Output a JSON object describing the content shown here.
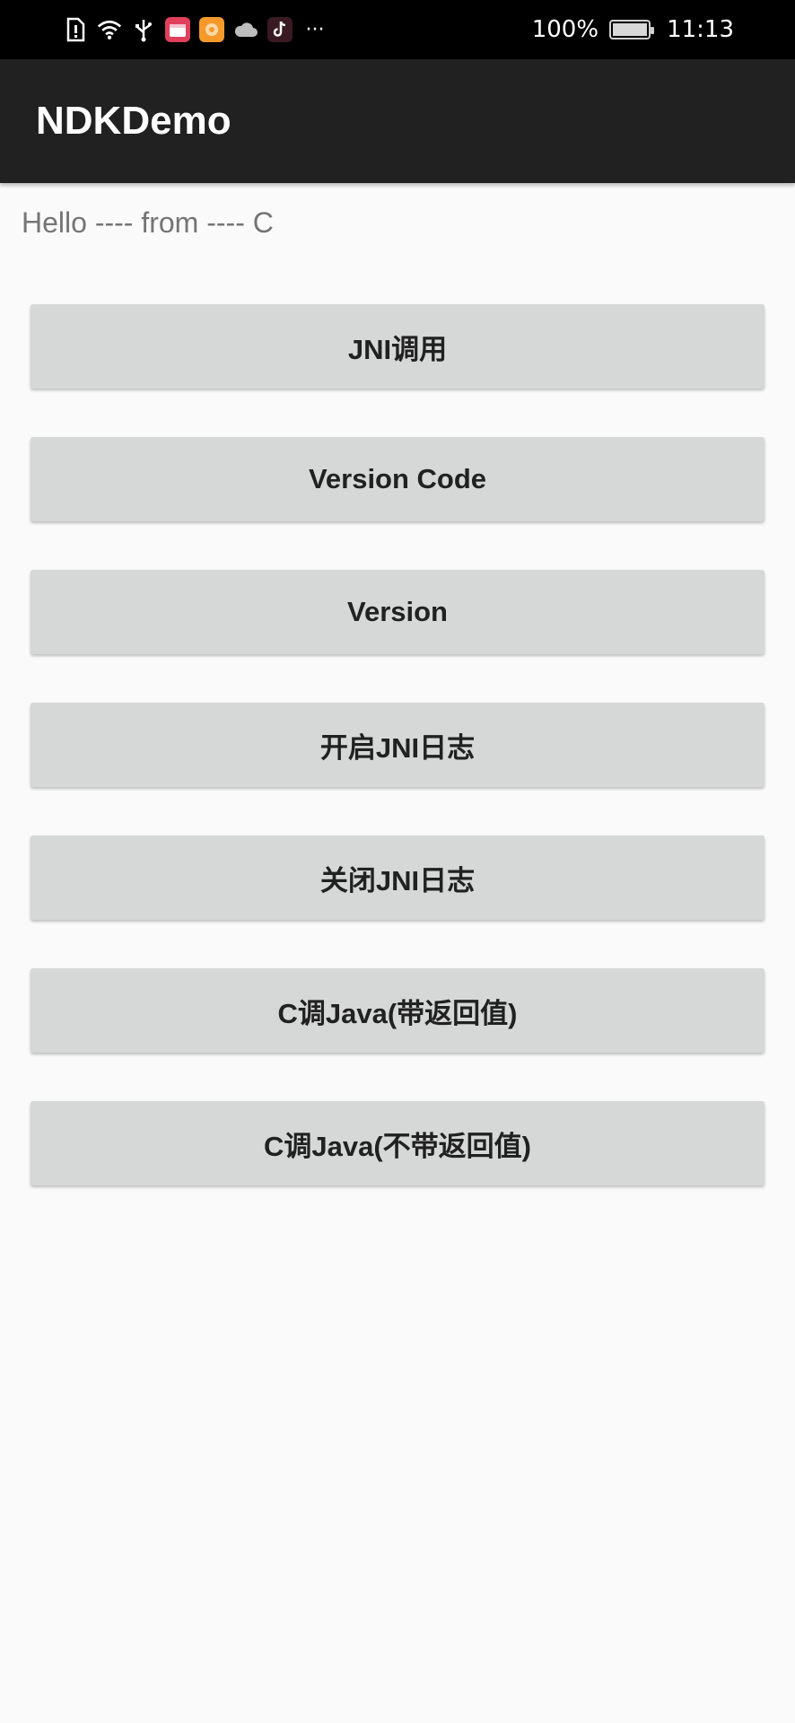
{
  "status_bar": {
    "icons": [
      "sim-alert-icon",
      "wifi-icon",
      "usb-icon",
      "calendar-app-icon",
      "music-app-icon",
      "cloud-icon",
      "tiktok-icon",
      "more-icon"
    ],
    "more_glyph": "···",
    "battery_percent": "100%",
    "battery_level": 1.0,
    "time": "11:13"
  },
  "app_bar": {
    "title": "NDKDemo"
  },
  "main": {
    "hello_text": "Hello ---- from ---- C",
    "buttons": [
      {
        "label": "JNI调用"
      },
      {
        "label": "Version Code"
      },
      {
        "label": "Version"
      },
      {
        "label": "开启JNI日志"
      },
      {
        "label": "关闭JNI日志"
      },
      {
        "label": "C调Java(带返回值)"
      },
      {
        "label": "C调Java(不带返回值)"
      }
    ]
  },
  "colors": {
    "status_bar_bg": "#000000",
    "app_bar_bg": "#212121",
    "page_bg": "#fafafa",
    "button_bg": "#d6d7d7",
    "button_text": "#212121",
    "hello_text": "#757575"
  }
}
